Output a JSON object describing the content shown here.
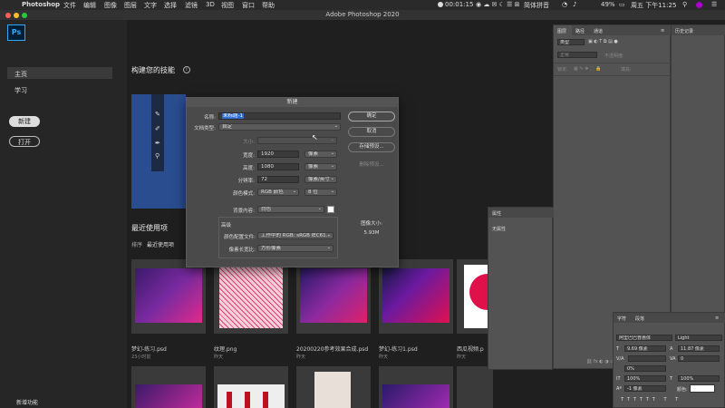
{
  "menubar": {
    "apple": "",
    "app": "Photoshop",
    "items": [
      "文件",
      "编辑",
      "图像",
      "图层",
      "文字",
      "选择",
      "滤镜",
      "3D",
      "视图",
      "窗口",
      "帮助"
    ],
    "timer": "00:01:15",
    "ime": "简体拼音",
    "battery": "49%",
    "clock": "周五 下午11:25"
  },
  "window": {
    "title": "Adobe Photoshop 2020"
  },
  "logo": "Ps",
  "sidebar": {
    "home": "主页",
    "learn": "学习",
    "new_btn": "新建",
    "open_btn": "打开",
    "whats_new": "新增功能"
  },
  "main": {
    "skills_title": "构建您的技能",
    "recent_title": "最近使用项",
    "sort_label": "排序",
    "sort_value": "最近使用项",
    "recent": [
      {
        "name": "梦幻-练习.psd",
        "time": "23小时前"
      },
      {
        "name": "纹理.png",
        "time": "昨天"
      },
      {
        "name": "20200220参考效果合成.psd",
        "time": "昨天"
      },
      {
        "name": "梦幻-练习1.psd",
        "time": "昨天"
      },
      {
        "name": "西瓜视频.p",
        "time": "昨天"
      }
    ]
  },
  "dialog": {
    "title": "新建",
    "name_label": "名称:",
    "name_value": "未标题-1",
    "doctype_label": "文档类型:",
    "doctype_value": "自定",
    "size_label": "大小:",
    "width_label": "宽度:",
    "width_value": "1920",
    "width_unit": "像素",
    "height_label": "高度:",
    "height_value": "1080",
    "height_unit": "像素",
    "resolution_label": "分辨率:",
    "resolution_value": "72",
    "resolution_unit": "像素/英寸",
    "colormode_label": "颜色模式:",
    "colormode_value": "RGB 颜色",
    "bitdepth_value": "8 位",
    "bg_label": "背景内容:",
    "bg_value": "白色",
    "advanced_label": "高级",
    "profile_label": "颜色配置文件:",
    "profile_value": "工作中的 RGB: sRGB IEC61...",
    "pixel_aspect_label": "像素长宽比:",
    "pixel_aspect_value": "方形像素",
    "ok": "确定",
    "cancel": "取消",
    "save_preset": "存储预设...",
    "delete_preset": "删除预设...",
    "image_size_label": "图像大小:",
    "image_size_value": "5.93M"
  },
  "layers_panel": {
    "tabs": [
      "图层",
      "路径",
      "通道"
    ],
    "kind_placeholder": "类型",
    "blend_value": "正常",
    "opacity_label": "不透明度:",
    "lock_label": "锁定:",
    "fill_label": "填充:"
  },
  "history_panel": {
    "tab": "历史记录"
  },
  "properties_panel": {
    "tab": "属性",
    "empty": "无属性"
  },
  "character_panel": {
    "tabs": [
      "字符",
      "段落"
    ],
    "font_family": "阿里巴巴普惠体",
    "font_style": "Light",
    "size": "9.69 像素",
    "leading": "11.87 像素",
    "kerning": "V/A",
    "tracking": "0",
    "scale_pct": "0%",
    "vscale": "100%",
    "hscale": "100%",
    "baseline": "-1 像素",
    "color_label": "颜色:"
  }
}
